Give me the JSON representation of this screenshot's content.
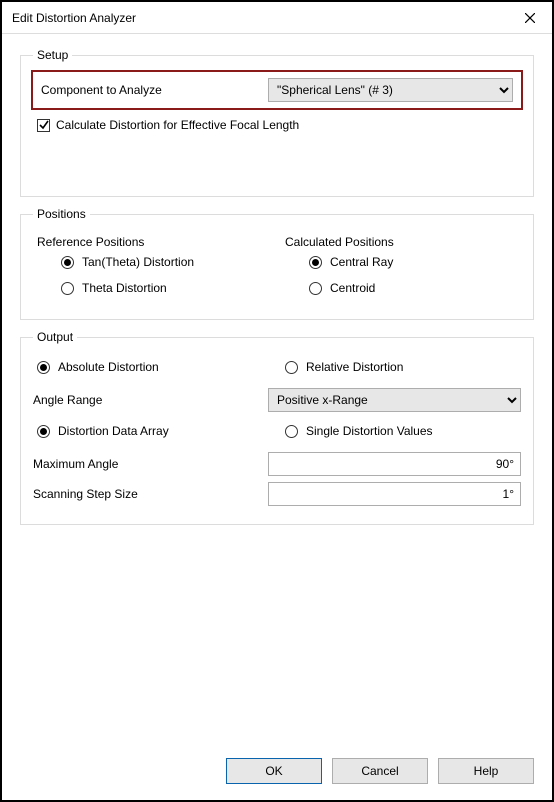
{
  "window": {
    "title": "Edit Distortion Analyzer"
  },
  "setup": {
    "legend": "Setup",
    "component_label": "Component to Analyze",
    "component_value": "\"Spherical Lens\" (# 3)",
    "calc_focal_label": "Calculate Distortion for Effective Focal Length",
    "calc_focal_checked": true
  },
  "positions": {
    "legend": "Positions",
    "ref_heading": "Reference Positions",
    "calc_heading": "Calculated Positions",
    "ref_options": {
      "tan_theta": "Tan(Theta) Distortion",
      "theta": "Theta Distortion"
    },
    "calc_options": {
      "central_ray": "Central Ray",
      "centroid": "Centroid"
    }
  },
  "output": {
    "legend": "Output",
    "abs_rel": {
      "absolute": "Absolute Distortion",
      "relative": "Relative Distortion"
    },
    "angle_range_label": "Angle Range",
    "angle_range_value": "Positive x-Range",
    "array_single": {
      "array": "Distortion Data Array",
      "single": "Single Distortion Values"
    },
    "max_angle_label": "Maximum Angle",
    "max_angle_value": "90°",
    "scan_step_label": "Scanning Step Size",
    "scan_step_value": "1°"
  },
  "buttons": {
    "ok": "OK",
    "cancel": "Cancel",
    "help": "Help"
  }
}
